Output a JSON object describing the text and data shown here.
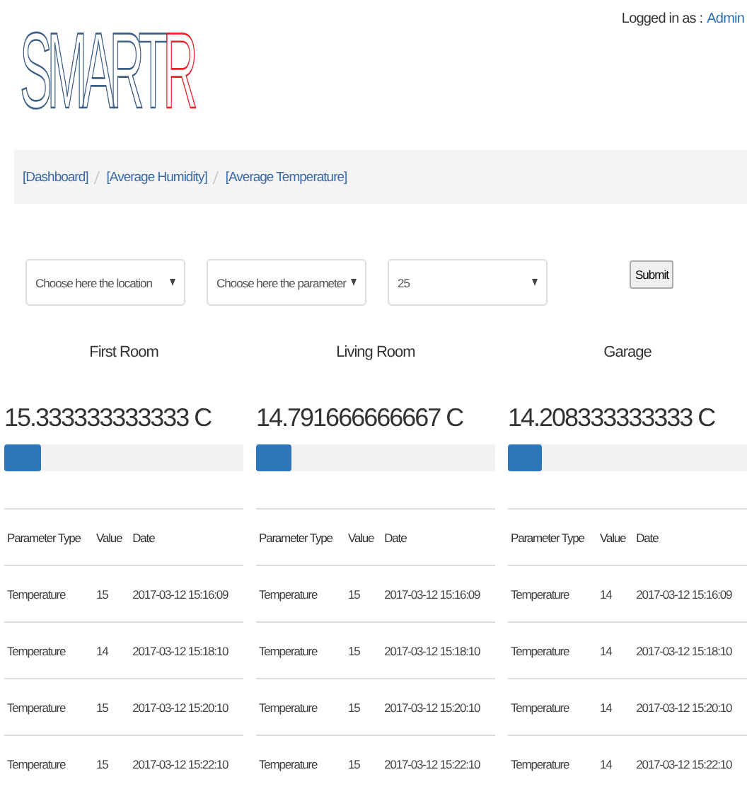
{
  "logo": {
    "text": "SMART",
    "accent": "R"
  },
  "user": {
    "label": "Logged in as :",
    "name": "Admin"
  },
  "breadcrumb": [
    "[Dashboard]",
    "[Average Humidity]",
    "[Average Temperature]"
  ],
  "filters": [
    {
      "kind": "select",
      "value": "Choose here the location"
    },
    {
      "kind": "select",
      "value": "Choose here the parameter"
    },
    {
      "kind": "select",
      "value": "25"
    },
    {
      "kind": "button",
      "value": "Submit"
    }
  ],
  "rooms": [
    {
      "name": "First Room",
      "average": "15.333333333333 C",
      "level": 0.153,
      "columns": [
        "Parameter Type",
        "Value",
        "Date"
      ],
      "rows": [
        [
          "Temperature",
          "15",
          "2017-03-12 15:16:09"
        ],
        [
          "Temperature",
          "14",
          "2017-03-12 15:18:10"
        ],
        [
          "Temperature",
          "15",
          "2017-03-12 15:20:10"
        ],
        [
          "Temperature",
          "15",
          "2017-03-12 15:22:10"
        ]
      ]
    },
    {
      "name": "Living Room",
      "average": "14.791666666667 C",
      "level": 0.148,
      "columns": [
        "Parameter Type",
        "Value",
        "Date"
      ],
      "rows": [
        [
          "Temperature",
          "15",
          "2017-03-12 15:16:09"
        ],
        [
          "Temperature",
          "15",
          "2017-03-12 15:18:10"
        ],
        [
          "Temperature",
          "15",
          "2017-03-12 15:20:10"
        ],
        [
          "Temperature",
          "15",
          "2017-03-12 15:22:10"
        ]
      ]
    },
    {
      "name": "Garage",
      "average": "14.208333333333 C",
      "level": 0.142,
      "columns": [
        "Parameter Type",
        "Value",
        "Date"
      ],
      "rows": [
        [
          "Temperature",
          "14",
          "2017-03-12 15:16:09"
        ],
        [
          "Temperature",
          "14",
          "2017-03-12 15:18:10"
        ],
        [
          "Temperature",
          "14",
          "2017-03-12 15:20:10"
        ],
        [
          "Temperature",
          "14",
          "2017-03-12 15:22:10"
        ]
      ]
    }
  ]
}
